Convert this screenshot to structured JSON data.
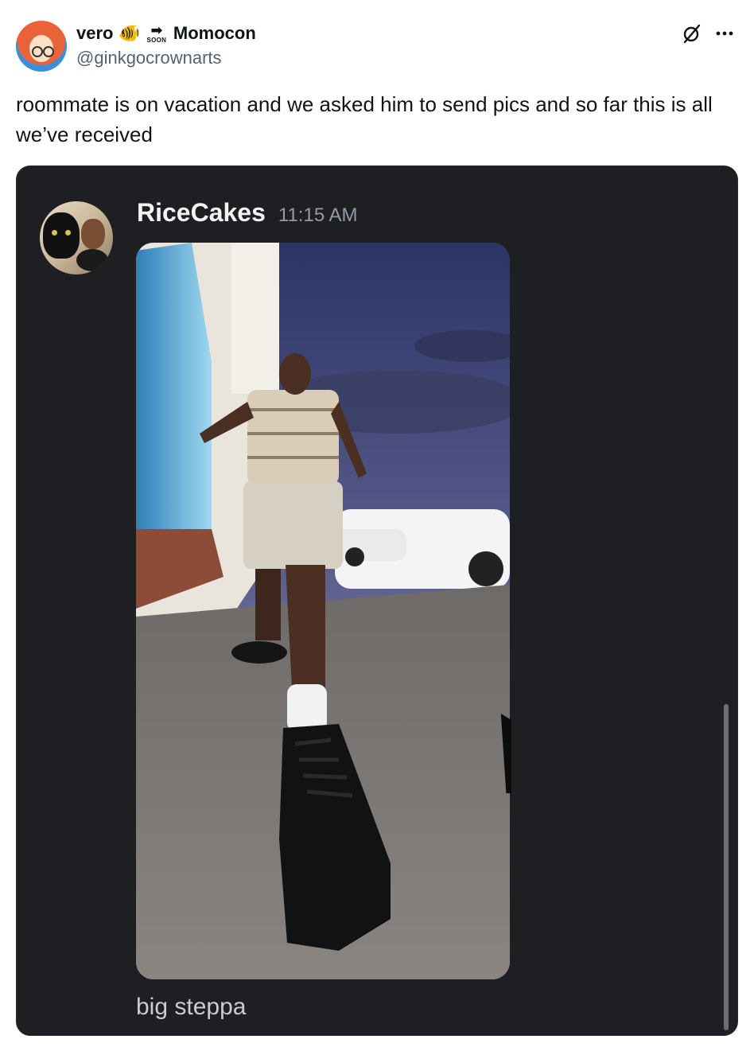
{
  "tweet": {
    "display_name": "vero",
    "name_suffix": "Momocon",
    "soon_badge": "SOON",
    "handle": "@ginkgocrownarts",
    "text": "roommate is on vacation and we asked him to send pics and so far this is all we’ve received",
    "icons": {
      "fish": "tropical-fish-icon",
      "soon": "soon-arrow-icon",
      "grok": "grok-icon",
      "more": "more-options-icon"
    }
  },
  "discord_message": {
    "username": "RiceCakes",
    "timestamp": "11:15 AM",
    "caption": "big steppa",
    "colors": {
      "background": "#1e1f22",
      "username": "#f2f3f5",
      "timestamp": "#949ba4",
      "caption": "#c9ccd1"
    }
  }
}
